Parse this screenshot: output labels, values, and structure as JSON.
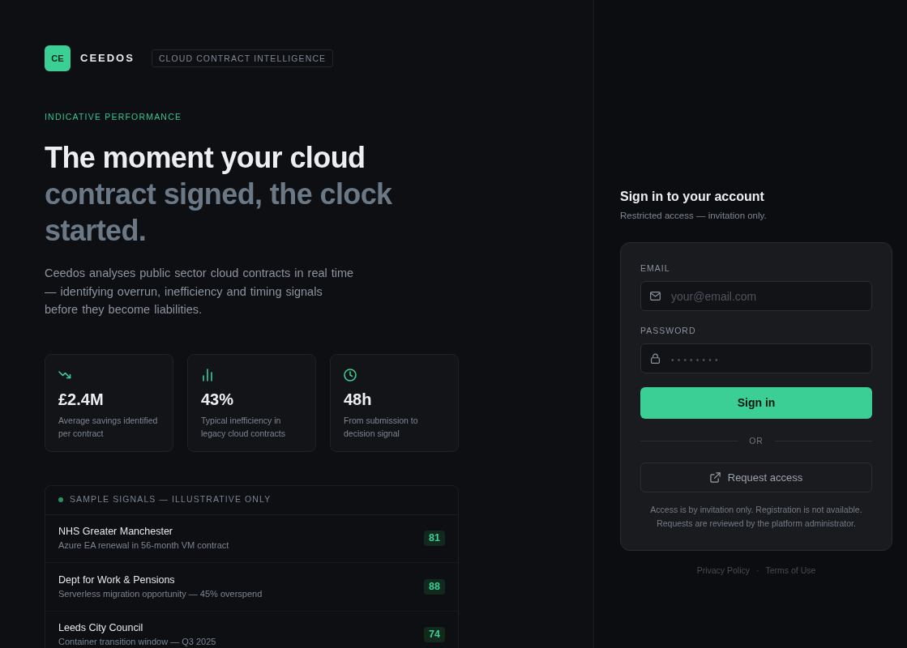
{
  "brand": {
    "logo": "CE",
    "name": "CEEDOS",
    "tagline": "CLOUD CONTRACT INTELLIGENCE"
  },
  "hero": {
    "eyebrow": "INDICATIVE PERFORMANCE",
    "headline_lead": "The moment your cloud",
    "headline_rest": "contract signed, the clock started.",
    "description": "Ceedos analyses public sector cloud contracts in real time — identifying overrun, inefficiency and timing signals before they become liabilities."
  },
  "stats": [
    {
      "value": "£2.4M",
      "label": "Average savings identified per contract"
    },
    {
      "value": "43%",
      "label": "Typical inefficiency in legacy cloud contracts"
    },
    {
      "value": "48h",
      "label": "From submission to decision signal"
    }
  ],
  "signals": {
    "title": "SAMPLE SIGNALS — ILLUSTRATIVE ONLY",
    "rows": [
      {
        "name": "NHS Greater Manchester",
        "detail": "Azure EA renewal in 56-month VM contract",
        "score": "81"
      },
      {
        "name": "Dept for Work & Pensions",
        "detail": "Serverless migration opportunity — 45% overspend",
        "score": "88"
      },
      {
        "name": "Leeds City Council",
        "detail": "Container transition window — Q3 2025",
        "score": "74"
      }
    ]
  },
  "signin": {
    "title": "Sign in to your account",
    "subtitle": "Restricted access — invitation only.",
    "fields": [
      {
        "kind": "email",
        "label": "EMAIL",
        "placeholder": "your@email.com"
      },
      {
        "kind": "password",
        "label": "PASSWORD",
        "placeholder": "••••••••"
      }
    ],
    "submit": "Sign in",
    "divider": "OR",
    "request_button": "Request access",
    "note": "Access is by invitation only. Registration is not available. Requests are reviewed by the platform administrator.",
    "footer_links": [
      "Privacy Policy",
      "Terms of Use"
    ],
    "footer_separator": "·"
  }
}
